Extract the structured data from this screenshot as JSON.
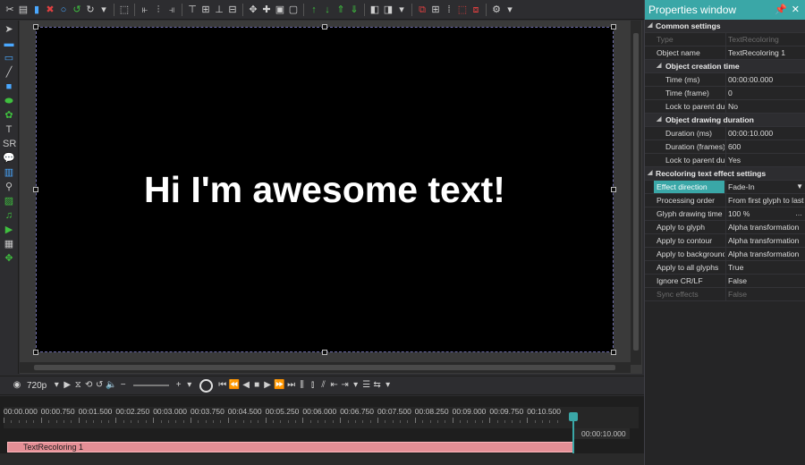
{
  "scene": {
    "text": "Hi I'm awesome text!"
  },
  "playback": {
    "quality": "720p"
  },
  "timeline": {
    "ticks": [
      "00:00.000",
      "00:00.750",
      "00:01.500",
      "00:02.250",
      "00:03.000",
      "00:03.750",
      "00:04.500",
      "00:05.250",
      "00:06.000",
      "00:06.750",
      "00:07.500",
      "00:08.250",
      "00:09.000",
      "00:09.750",
      "00:10.500"
    ],
    "end_time": "00:00:10.000",
    "track_label": "TextRecoloring 1"
  },
  "properties": {
    "title": "Properties window",
    "common_settings": "Common settings",
    "type_label": "Type",
    "type_value": "TextRecoloring",
    "object_name_label": "Object name",
    "object_name_value": "TextRecoloring 1",
    "creation_time": "Object creation time",
    "time_ms_label": "Time (ms)",
    "time_ms_value": "00:00:00.000",
    "time_frame_label": "Time (frame)",
    "time_frame_value": "0",
    "lock_parent1_label": "Lock to parent du",
    "lock_parent1_value": "No",
    "drawing_duration": "Object drawing duration",
    "duration_ms_label": "Duration (ms)",
    "duration_ms_value": "00:00:10.000",
    "duration_frames_label": "Duration (frames)",
    "duration_frames_value": "600",
    "lock_parent2_label": "Lock to parent du",
    "lock_parent2_value": "Yes",
    "recoloring_settings": "Recoloring text effect settings",
    "effect_direction_label": "Effect direction",
    "effect_direction_value": "Fade-In",
    "processing_order_label": "Processing order",
    "processing_order_value": "From first glyph to last",
    "glyph_drawing_label": "Glyph drawing time",
    "glyph_drawing_value": "100 %",
    "apply_glyph_label": "Apply to glyph",
    "apply_glyph_value": "Alpha transformation",
    "apply_contour_label": "Apply to contour",
    "apply_contour_value": "Alpha transformation",
    "apply_background_label": "Apply to background",
    "apply_background_value": "Alpha transformation",
    "apply_all_label": "Apply to all glyphs",
    "apply_all_value": "True",
    "ignore_crlf_label": "Ignore CR/LF",
    "ignore_crlf_value": "False",
    "sync_effects_label": "Sync effects",
    "sync_effects_value": "False"
  },
  "colors": {
    "accent": "#3aa7a7",
    "track": "#e58f96",
    "canvas": "#000000"
  }
}
